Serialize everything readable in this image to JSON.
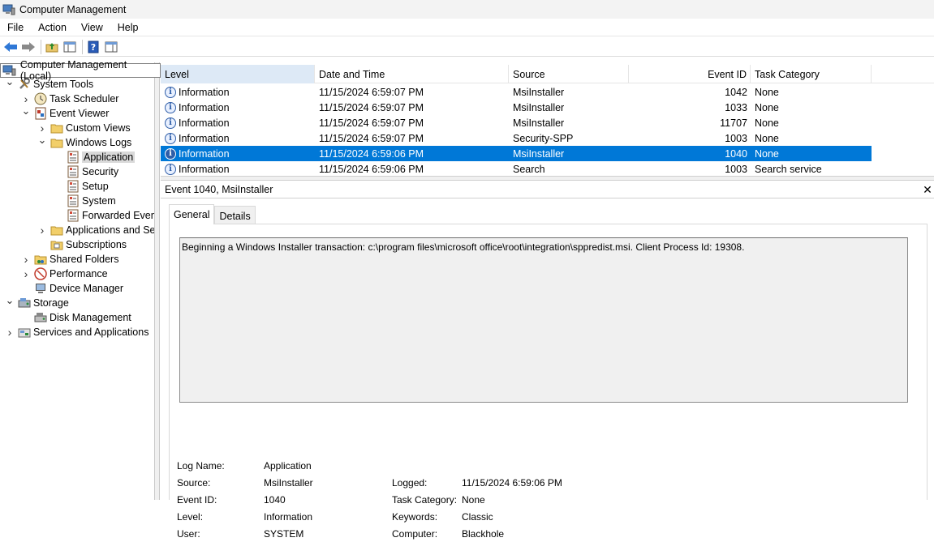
{
  "window": {
    "title": "Computer Management"
  },
  "menu": [
    "File",
    "Action",
    "View",
    "Help"
  ],
  "tree": {
    "root": "Computer Management (Local)",
    "nodes": [
      {
        "label": "System Tools",
        "icon": "tools-icon",
        "level": 1,
        "state": "expanded"
      },
      {
        "label": "Task Scheduler",
        "icon": "clock-icon",
        "level": 2,
        "state": "collapsed"
      },
      {
        "label": "Event Viewer",
        "icon": "event-viewer-icon",
        "level": 2,
        "state": "expanded"
      },
      {
        "label": "Custom Views",
        "icon": "folder-icon",
        "level": 3,
        "state": "collapsed"
      },
      {
        "label": "Windows Logs",
        "icon": "folder-icon",
        "level": 3,
        "state": "expanded"
      },
      {
        "label": "Application",
        "icon": "log-icon",
        "level": 4,
        "state": "leaf",
        "selected": true
      },
      {
        "label": "Security",
        "icon": "log-icon",
        "level": 4,
        "state": "leaf"
      },
      {
        "label": "Setup",
        "icon": "log-icon",
        "level": 4,
        "state": "leaf"
      },
      {
        "label": "System",
        "icon": "log-icon",
        "level": 4,
        "state": "leaf"
      },
      {
        "label": "Forwarded Event",
        "icon": "log-icon",
        "level": 4,
        "state": "leaf"
      },
      {
        "label": "Applications and Se",
        "icon": "folder-icon",
        "level": 3,
        "state": "collapsed"
      },
      {
        "label": "Subscriptions",
        "icon": "subscriptions-icon",
        "level": 3,
        "state": "leaf"
      },
      {
        "label": "Shared Folders",
        "icon": "shared-folder-icon",
        "level": 2,
        "state": "collapsed"
      },
      {
        "label": "Performance",
        "icon": "performance-icon",
        "level": 2,
        "state": "collapsed"
      },
      {
        "label": "Device Manager",
        "icon": "device-manager-icon",
        "level": 2,
        "state": "leaf"
      },
      {
        "label": "Storage",
        "icon": "storage-icon",
        "level": 1,
        "state": "expanded"
      },
      {
        "label": "Disk Management",
        "icon": "disk-icon",
        "level": 2,
        "state": "leaf"
      },
      {
        "label": "Services and Applications",
        "icon": "services-icon",
        "level": 1,
        "state": "collapsed"
      }
    ]
  },
  "events": {
    "columns": [
      "Level",
      "Date and Time",
      "Source",
      "Event ID",
      "Task Category"
    ],
    "rows": [
      {
        "level": "Information",
        "datetime": "11/15/2024 6:59:07 PM",
        "source": "MsiInstaller",
        "id": "1042",
        "category": "None"
      },
      {
        "level": "Information",
        "datetime": "11/15/2024 6:59:07 PM",
        "source": "MsiInstaller",
        "id": "1033",
        "category": "None"
      },
      {
        "level": "Information",
        "datetime": "11/15/2024 6:59:07 PM",
        "source": "MsiInstaller",
        "id": "11707",
        "category": "None"
      },
      {
        "level": "Information",
        "datetime": "11/15/2024 6:59:07 PM",
        "source": "Security-SPP",
        "id": "1003",
        "category": "None"
      },
      {
        "level": "Information",
        "datetime": "11/15/2024 6:59:06 PM",
        "source": "MsiInstaller",
        "id": "1040",
        "category": "None",
        "selected": true
      },
      {
        "level": "Information",
        "datetime": "11/15/2024 6:59:06 PM",
        "source": "Search",
        "id": "1003",
        "category": "Search service"
      }
    ]
  },
  "detail": {
    "title": "Event 1040, MsiInstaller",
    "tabs": [
      "General",
      "Details"
    ],
    "message": "Beginning a Windows Installer transaction: c:\\program files\\microsoft office\\root\\integration\\sppredist.msi. Client Process Id: 19308.",
    "fields": {
      "log_name_label": "Log Name:",
      "log_name": "Application",
      "source_label": "Source:",
      "source": "MsiInstaller",
      "logged_label": "Logged:",
      "logged": "11/15/2024 6:59:06 PM",
      "event_id_label": "Event ID:",
      "event_id": "1040",
      "task_category_label": "Task Category:",
      "task_category": "None",
      "level_label": "Level:",
      "level": "Information",
      "keywords_label": "Keywords:",
      "keywords": "Classic",
      "user_label": "User:",
      "user": "SYSTEM",
      "computer_label": "Computer:",
      "computer": "Blackhole"
    }
  },
  "colors": {
    "selection": "#0078d7",
    "info_icon": "#2f5ea8",
    "tree_selection": "#d9d9d9"
  }
}
